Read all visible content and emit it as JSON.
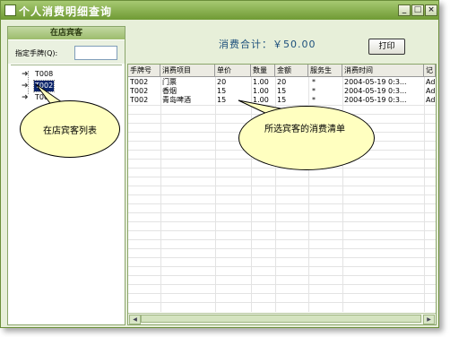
{
  "window": {
    "title": "个人消费明细查询",
    "buttons": {
      "minimize": "_",
      "maximize": "□",
      "close": "×"
    }
  },
  "left": {
    "header": "在店宾客",
    "search_label": "指定手牌(Q):",
    "search_value": "",
    "guests": [
      {
        "label": "T008",
        "selected": false
      },
      {
        "label": "T002",
        "selected": true
      },
      {
        "label": "T001",
        "selected": false
      }
    ]
  },
  "summary": {
    "total_text": "消费合计：￥50.00",
    "print_label": "打印"
  },
  "table": {
    "columns": [
      "手牌号",
      "消费项目",
      "单价",
      "数量",
      "金额",
      "服务生",
      "消费时间",
      "记"
    ],
    "rows": [
      [
        "T002",
        "门票",
        "20",
        "1.00",
        "20",
        "*",
        "2004-05-19 0:3...",
        "Adm"
      ],
      [
        "T002",
        "香烟",
        "15",
        "1.00",
        "15",
        "*",
        "2004-05-19 0:3...",
        "Adm"
      ],
      [
        "T002",
        "青岛啤酒",
        "15",
        "1.00",
        "15",
        "*",
        "2004-05-19 0:3...",
        "Adm"
      ]
    ]
  },
  "callouts": {
    "guest_list": "在店宾客列表",
    "consumption_list": "所选宾客的消费清单"
  }
}
